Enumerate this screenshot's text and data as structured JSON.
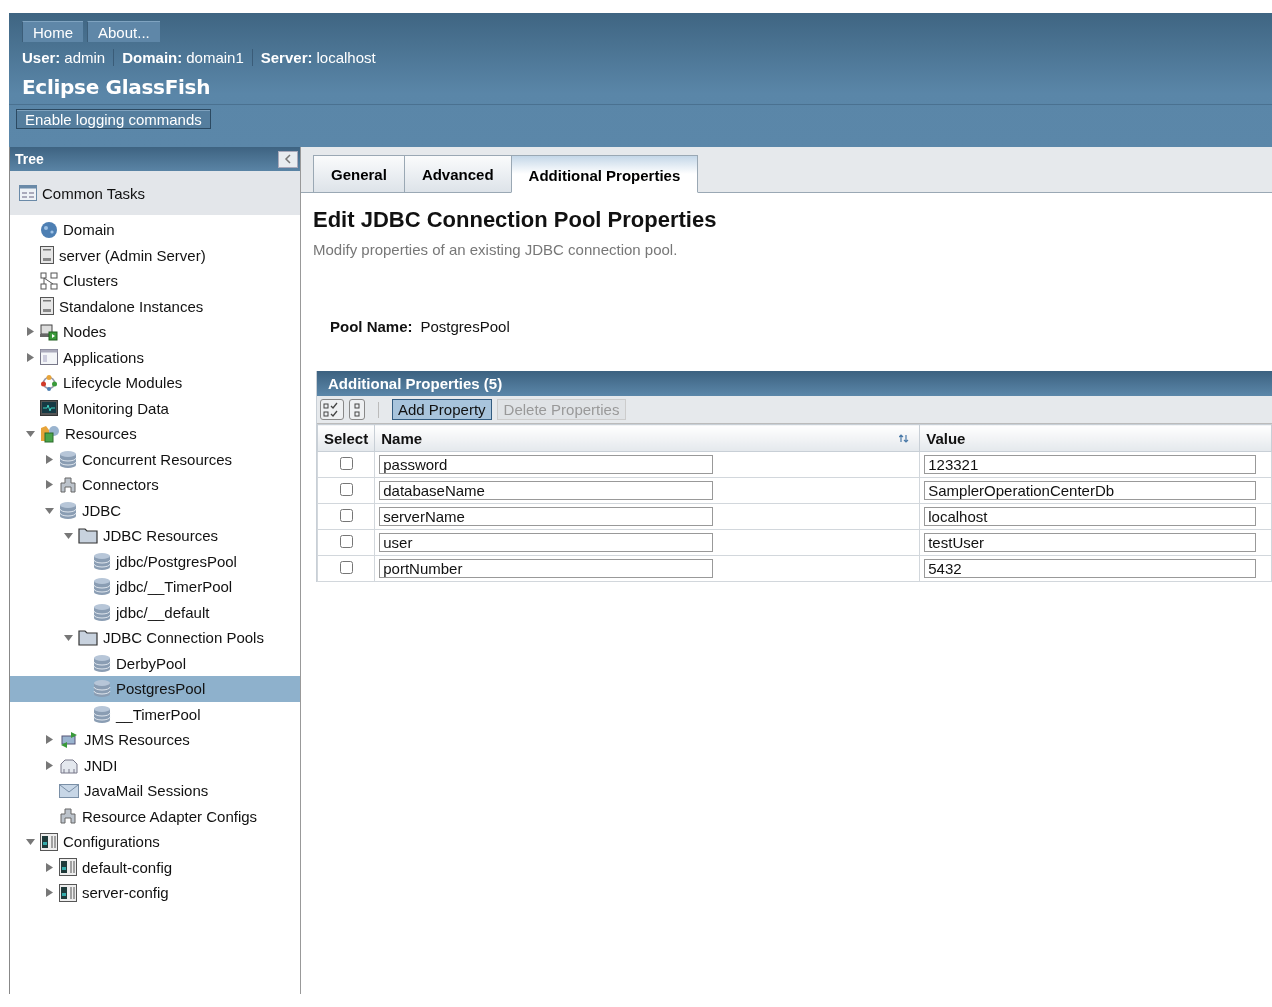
{
  "masthead": {
    "nav": [
      "Home",
      "About..."
    ],
    "info": [
      {
        "label": "User:",
        "value": "admin"
      },
      {
        "label": "Domain:",
        "value": "domain1"
      },
      {
        "label": "Server:",
        "value": "localhost"
      }
    ],
    "product": "Eclipse GlassFish",
    "logging_button": "Enable logging commands"
  },
  "sidebar": {
    "title": "Tree",
    "common_tasks": "Common Tasks",
    "items": [
      {
        "label": "Domain",
        "kind": "globe",
        "selected": false
      },
      {
        "label": "server (Admin Server)",
        "kind": "server",
        "selected": false
      },
      {
        "label": "Clusters",
        "kind": "cluster",
        "selected": false
      },
      {
        "label": "Standalone Instances",
        "kind": "server",
        "selected": false
      },
      {
        "label": "Nodes",
        "kind": "nodes",
        "selected": false,
        "expanded": false
      },
      {
        "label": "Applications",
        "kind": "apps",
        "selected": false,
        "expanded": false
      },
      {
        "label": "Lifecycle Modules",
        "kind": "lifecycle",
        "selected": false
      },
      {
        "label": "Monitoring Data",
        "kind": "monitor",
        "selected": false
      },
      {
        "label": "Resources",
        "kind": "resources",
        "selected": false,
        "expanded": true,
        "children": [
          {
            "label": "Concurrent Resources",
            "kind": "database",
            "selected": false,
            "expanded": false
          },
          {
            "label": "Connectors",
            "kind": "connector",
            "selected": false,
            "expanded": false
          },
          {
            "label": "JDBC",
            "kind": "database",
            "selected": false,
            "expanded": true,
            "children": [
              {
                "label": "JDBC Resources",
                "kind": "folder",
                "selected": false,
                "expanded": true,
                "children": [
                  {
                    "label": "jdbc/PostgresPool",
                    "kind": "database",
                    "selected": false
                  },
                  {
                    "label": "jdbc/__TimerPool",
                    "kind": "database",
                    "selected": false
                  },
                  {
                    "label": "jdbc/__default",
                    "kind": "database",
                    "selected": false
                  }
                ]
              },
              {
                "label": "JDBC Connection Pools",
                "kind": "folder",
                "selected": false,
                "expanded": true,
                "children": [
                  {
                    "label": "DerbyPool",
                    "kind": "database",
                    "selected": false
                  },
                  {
                    "label": "PostgresPool",
                    "kind": "database",
                    "selected": true
                  },
                  {
                    "label": "__TimerPool",
                    "kind": "database",
                    "selected": false
                  }
                ]
              }
            ]
          },
          {
            "label": "JMS Resources",
            "kind": "jms",
            "selected": false,
            "expanded": false
          },
          {
            "label": "JNDI",
            "kind": "jndi",
            "selected": false,
            "expanded": false
          },
          {
            "label": "JavaMail Sessions",
            "kind": "mail",
            "selected": false
          },
          {
            "label": "Resource Adapter Configs",
            "kind": "connector",
            "selected": false
          }
        ]
      },
      {
        "label": "Configurations",
        "kind": "config",
        "selected": false,
        "expanded": true,
        "children": [
          {
            "label": "default-config",
            "kind": "config",
            "selected": false,
            "expanded": false
          },
          {
            "label": "server-config",
            "kind": "config",
            "selected": false,
            "expanded": false
          }
        ]
      }
    ]
  },
  "tabs": [
    {
      "label": "General",
      "selected": false
    },
    {
      "label": "Advanced",
      "selected": false
    },
    {
      "label": "Additional Properties",
      "selected": true
    }
  ],
  "page": {
    "title": "Edit JDBC Connection Pool Properties",
    "description": "Modify properties of an existing JDBC connection pool.",
    "pool_name_label": "Pool Name:",
    "pool_name": "PostgresPool"
  },
  "table": {
    "title": "Additional Properties (5)",
    "add_button": "Add Property",
    "delete_button": "Delete Properties",
    "delete_disabled": true,
    "columns": [
      "Select",
      "Name",
      "Value"
    ],
    "rows": [
      {
        "checked": false,
        "name": "password",
        "value": "123321"
      },
      {
        "checked": false,
        "name": "databaseName",
        "value": "SamplerOperationCenterDb"
      },
      {
        "checked": false,
        "name": "serverName",
        "value": "localhost"
      },
      {
        "checked": false,
        "name": "user",
        "value": "testUser"
      },
      {
        "checked": false,
        "name": "portNumber",
        "value": "5432"
      }
    ]
  }
}
